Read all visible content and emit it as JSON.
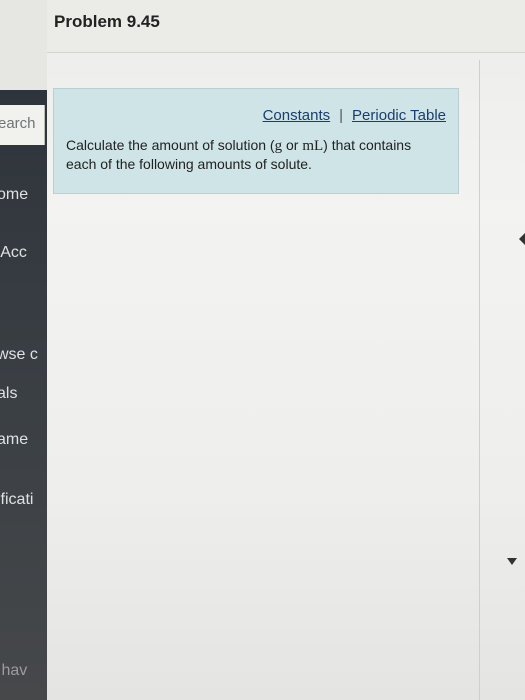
{
  "page": {
    "title": "Problem 9.45"
  },
  "sidebar": {
    "search_placeholder": "earch",
    "items": [
      {
        "label": "ome"
      },
      {
        "label": " Acc"
      },
      {
        "label": "wse c"
      },
      {
        "label": "als"
      },
      {
        "label": "ame"
      },
      {
        "label": "ificati"
      },
      {
        "label": "Ihav"
      }
    ]
  },
  "panel": {
    "link_constants": "Constants",
    "separator": "|",
    "link_periodic_table": "Periodic Table",
    "instruction_part1": "Calculate the amount of solution (",
    "instruction_math1": "g",
    "instruction_part2": " or ",
    "instruction_math2": "mL",
    "instruction_part3": ") that contains each of the following amounts of solute."
  },
  "colors": {
    "panel_bg": "#cfe4e6",
    "sidebar_bg": "#2a3138",
    "link": "#1b3d6f"
  }
}
